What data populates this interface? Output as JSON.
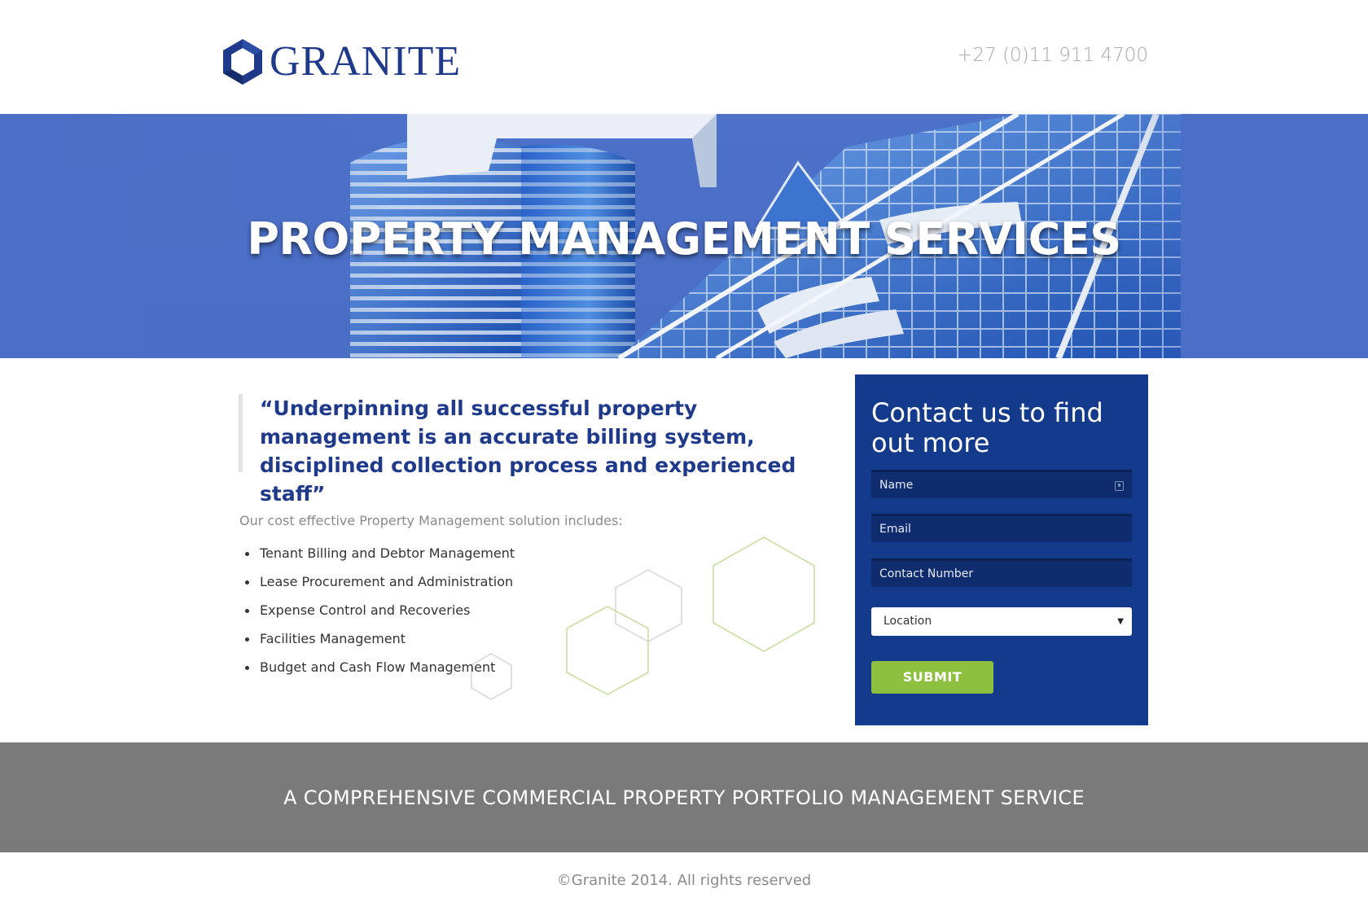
{
  "header": {
    "brand": "GRANITE",
    "phone": "+27 (0)11 911 4700"
  },
  "hero": {
    "title": "PROPERTY MANAGEMENT SERVICES"
  },
  "main": {
    "quote": "“Underpinning all successful property management is an accurate billing system, disciplined collection process and experienced staff”",
    "intro": "Our cost effective Property Management solution includes:",
    "features": [
      "Tenant Billing and Debtor Management",
      "Lease Procurement and Administration",
      "Expense Control and Recoveries",
      "Facilities Management",
      "Budget and Cash Flow Management"
    ]
  },
  "contact": {
    "title": "Contact us to find out more",
    "name_placeholder": "Name",
    "email_placeholder": "Email",
    "phone_placeholder": "Contact Number",
    "location_selected": "Location",
    "submit_label": "SUBMIT"
  },
  "banner": {
    "text": "A COMPREHENSIVE COMMERCIAL PROPERTY PORTFOLIO MANAGEMENT SERVICE"
  },
  "footer": {
    "copyright": "©Granite 2014. All rights reserved"
  },
  "colors": {
    "brand_blue": "#1f3a8a",
    "panel_blue": "#143a8c",
    "accent_green": "#8dc03f",
    "banner_grey": "#7a7a7a"
  },
  "icons": {
    "logo": "hexagon-logo-icon",
    "field": "contact-card-icon",
    "select": "dropdown-arrow-icon"
  }
}
